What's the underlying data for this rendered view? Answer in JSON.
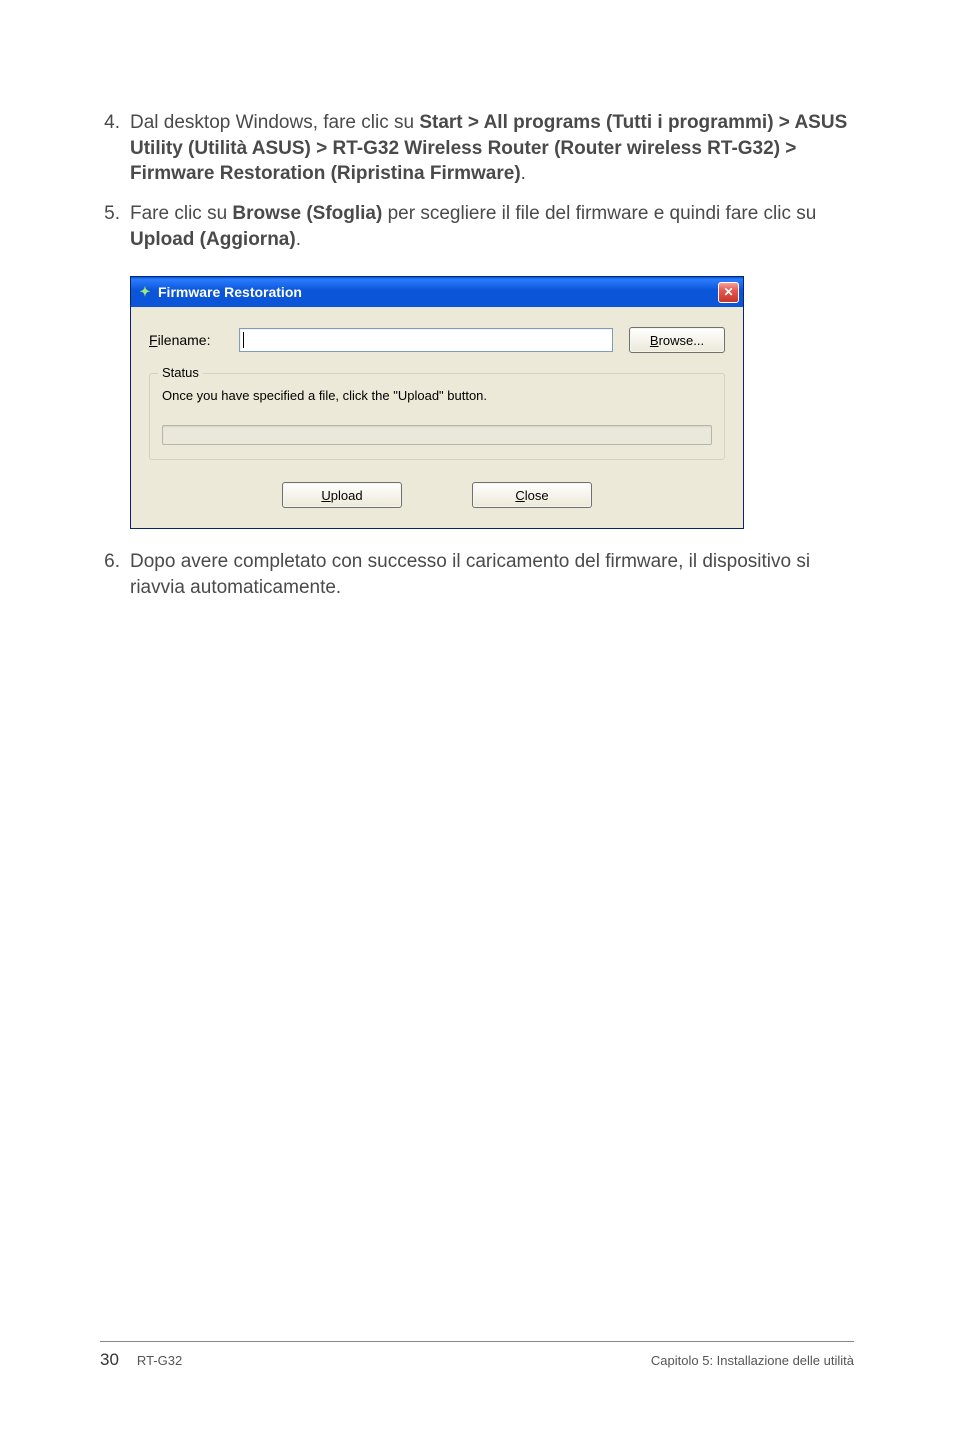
{
  "steps": {
    "s4": {
      "num": "4.",
      "t1": "Dal desktop Windows, fare clic su ",
      "b1": "Start > All programs (Tutti i programmi) > ASUS Utility (Utilità ASUS) > RT-G32 Wireless Router (Router wireless RT-G32) > Firmware Restoration (Ripristina Firmware)",
      "t2": "."
    },
    "s5": {
      "num": "5.",
      "t1": "Fare clic su ",
      "b1": "Browse (Sfoglia)",
      "t2": " per scegliere il file del firmware e quindi fare clic su ",
      "b2": "Upload (Aggiorna)",
      "t3": "."
    },
    "s6": {
      "num": "6.",
      "t1": "Dopo avere completato con successo il caricamento del firmware, il dispositivo si riavvia automaticamente."
    }
  },
  "dialog": {
    "title": "Firmware Restoration",
    "icon_glyph": "✦",
    "close_glyph": "✕",
    "filename_label_pre": "F",
    "filename_label_post": "ilename:",
    "browse_pre": "B",
    "browse_post": "rowse...",
    "status_legend": "Status",
    "status_text": "Once you have specified a file, click the \"Upload\" button.",
    "upload_pre": "U",
    "upload_post": "pload",
    "close_pre": "C",
    "close_post": "lose"
  },
  "footer": {
    "page": "30",
    "product": "RT-G32",
    "chapter": "Capitolo 5: Installazione delle utilità"
  }
}
